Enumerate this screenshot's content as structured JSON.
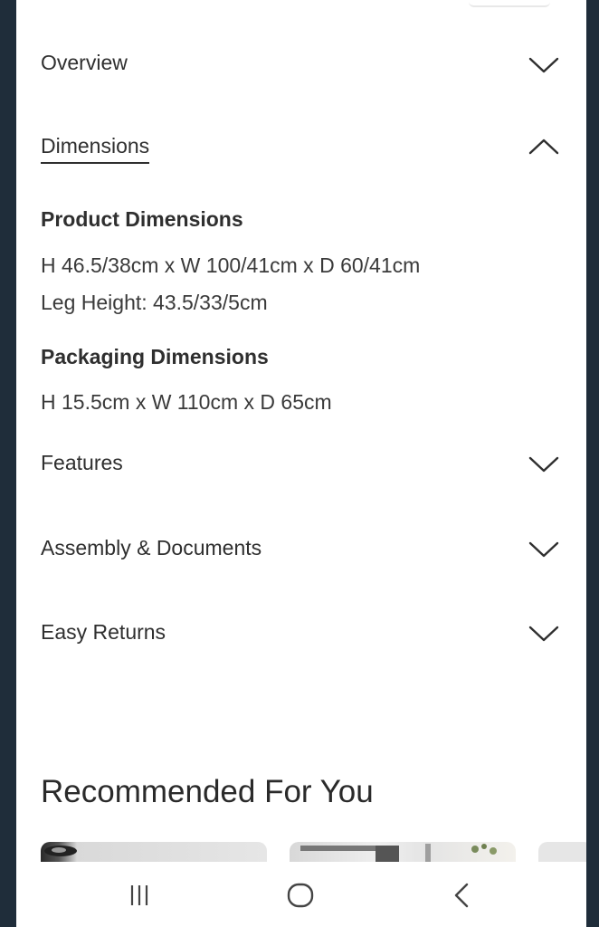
{
  "accordion": {
    "overview": {
      "label": "Overview",
      "icon": "chevron-down-icon"
    },
    "dimensions": {
      "label": "Dimensions",
      "icon": "chevron-up-icon"
    },
    "features": {
      "label": "Features",
      "icon": "chevron-down-icon"
    },
    "assembly": {
      "label": "Assembly & Documents",
      "icon": "chevron-down-icon"
    },
    "returns": {
      "label": "Easy Returns",
      "icon": "chevron-down-icon"
    }
  },
  "dimensions_panel": {
    "product_title": "Product Dimensions",
    "product_size": "H 46.5/38cm x W 100/41cm x D 60/41cm",
    "leg_height": "Leg Height: 43.5/33/5cm",
    "packaging_title": "Packaging Dimensions",
    "packaging_size": "H 15.5cm x W 110cm x D 65cm"
  },
  "recommended": {
    "title": "Recommended For You"
  },
  "navbar": {
    "recents_icon": "recent-apps-icon",
    "home_icon": "home-icon",
    "back_icon": "back-icon"
  },
  "colors": {
    "frame_background": "#1f2d3a",
    "text": "#2f2f2f"
  }
}
